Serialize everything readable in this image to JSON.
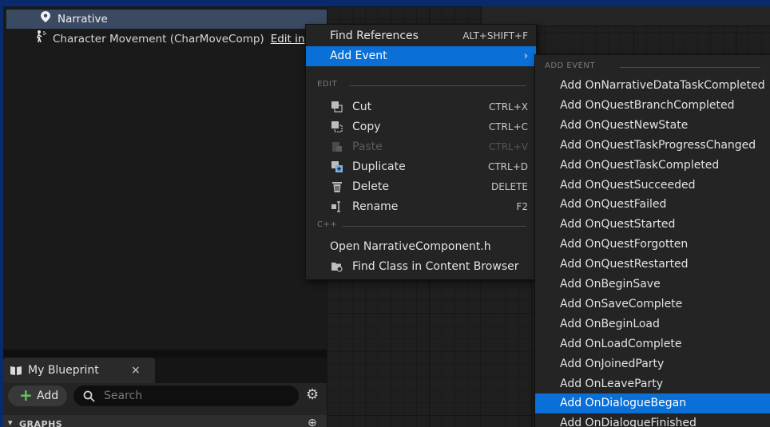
{
  "components": {
    "items": [
      {
        "label": "Narrative",
        "icon": "location-pin-icon"
      },
      {
        "label": "Character Movement (CharMoveComp)",
        "icon": "character-movement-icon",
        "link": "Edit in"
      }
    ]
  },
  "my_blueprint": {
    "tab_title": "My Blueprint",
    "close": "×",
    "add_label": "Add",
    "search_placeholder": "Search",
    "graphs_header": "GRAPHS"
  },
  "context_menu": {
    "items": [
      {
        "label": "Find References",
        "shortcut": "ALT+SHIFT+F"
      },
      {
        "label": "Add Event",
        "arrow": "›"
      }
    ],
    "edit_section": "EDIT",
    "edit_items": [
      {
        "label": "Cut",
        "shortcut": "CTRL+X",
        "icon": "cut-icon"
      },
      {
        "label": "Copy",
        "shortcut": "CTRL+C",
        "icon": "copy-icon"
      },
      {
        "label": "Paste",
        "shortcut": "CTRL+V",
        "icon": "paste-icon",
        "disabled": true
      },
      {
        "label": "Duplicate",
        "shortcut": "CTRL+D",
        "icon": "duplicate-icon"
      },
      {
        "label": "Delete",
        "shortcut": "DELETE",
        "icon": "trash-icon"
      },
      {
        "label": "Rename",
        "shortcut": "F2",
        "icon": "rename-icon"
      }
    ],
    "cpp_section": "C++",
    "cpp_items": [
      {
        "label": "Open NarrativeComponent.h"
      },
      {
        "label": "Find Class in Content Browser",
        "icon": "content-browser-icon"
      }
    ]
  },
  "submenu": {
    "header": "ADD EVENT",
    "items": [
      "Add OnNarrativeDataTaskCompleted",
      "Add OnQuestBranchCompleted",
      "Add OnQuestNewState",
      "Add OnQuestTaskProgressChanged",
      "Add OnQuestTaskCompleted",
      "Add OnQuestSucceeded",
      "Add OnQuestFailed",
      "Add OnQuestStarted",
      "Add OnQuestForgotten",
      "Add OnQuestRestarted",
      "Add OnBeginSave",
      "Add OnSaveComplete",
      "Add OnBeginLoad",
      "Add OnLoadComplete",
      "Add OnJoinedParty",
      "Add OnLeaveParty",
      "Add OnDialogueBegan",
      "Add OnDialogueFinished"
    ],
    "highlighted": "Add OnDialogueBegan"
  },
  "colors": {
    "highlight": "#0a6fd6",
    "selected_row": "#3b4a63",
    "add_plus": "#64c85a"
  }
}
